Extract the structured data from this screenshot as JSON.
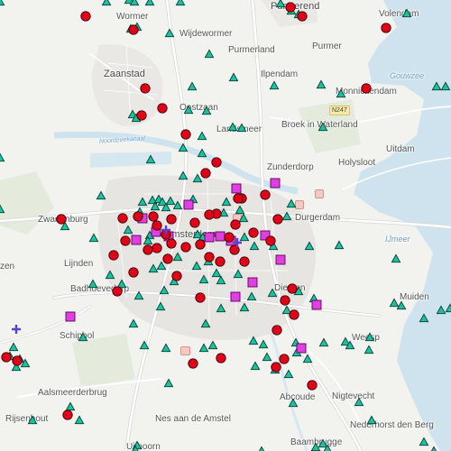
{
  "map": {
    "colors": {
      "land": "#f2f2ef",
      "water": "#cfe3ef",
      "road": "#ffffff",
      "road_edge": "#d6d6d2",
      "urban": "#e6e5e1",
      "green": "#dfe8d6",
      "circle_marker": "#e0001a",
      "triangle_marker": "#18c4a0",
      "square_marker": "#e040e0",
      "plus_marker": "#5a3fd0"
    },
    "marker_shapes": [
      "red-circle",
      "teal-triangle",
      "magenta-square",
      "purple-plus"
    ],
    "place_labels": [
      {
        "id": "wormer",
        "text": "Wormer"
      },
      {
        "id": "purmerend",
        "text": "Purmerend"
      },
      {
        "id": "volendam",
        "text": "Volendam"
      },
      {
        "id": "wijdewormer",
        "text": "Wijdewormer"
      },
      {
        "id": "purmerland",
        "text": "Purmerland"
      },
      {
        "id": "purmer",
        "text": "Purmer"
      },
      {
        "id": "zaanstad",
        "text": "Zaanstad"
      },
      {
        "id": "ilpendam",
        "text": "Ilpendam"
      },
      {
        "id": "monnickendam",
        "text": "Monnickendam"
      },
      {
        "id": "oostzaan",
        "text": "Oostzaan"
      },
      {
        "id": "landsmeer",
        "text": "Landsmeer"
      },
      {
        "id": "broek",
        "text": "Broek in Waterland"
      },
      {
        "id": "uitdam",
        "text": "Uitdam"
      },
      {
        "id": "zunderdorp",
        "text": "Zunderdorp"
      },
      {
        "id": "holysloot",
        "text": "Holysloot"
      },
      {
        "id": "zwanenburg",
        "text": "Zwanenburg"
      },
      {
        "id": "durgerdam",
        "text": "Durgerdam"
      },
      {
        "id": "amsterdam",
        "text": "Amsterdam"
      },
      {
        "id": "lijnden",
        "text": "Lijnden"
      },
      {
        "id": "badhoevedorp",
        "text": "Badhoevedorp"
      },
      {
        "id": "diemen",
        "text": "Diemen"
      },
      {
        "id": "muiden",
        "text": "Muiden"
      },
      {
        "id": "zen",
        "text": "zen"
      },
      {
        "id": "schiphol",
        "text": "Schiphol"
      },
      {
        "id": "weesp",
        "text": "Weesp"
      },
      {
        "id": "aalsmeerderbrug",
        "text": "Aalsmeerderbrug"
      },
      {
        "id": "abcoude",
        "text": "Abcoude"
      },
      {
        "id": "nigtevecht",
        "text": "Nigtevecht"
      },
      {
        "id": "rijsenhout",
        "text": "Rijsenhout"
      },
      {
        "id": "nesaandeamstel",
        "text": "Nes aan de Amstel"
      },
      {
        "id": "nederhorst",
        "text": "Nederhorst den Berg"
      },
      {
        "id": "uithoorn",
        "text": "Uithoorn"
      },
      {
        "id": "baambrugge",
        "text": "Baambrugge"
      }
    ],
    "water_labels": [
      {
        "id": "gouwzee",
        "text": "Gouwzee"
      },
      {
        "id": "ijmeer",
        "text": "IJmeer"
      },
      {
        "id": "noordzeekanaal",
        "text": "Noordzeekanaal"
      }
    ],
    "road_shields": [
      {
        "id": "n247",
        "text": "N247"
      }
    ]
  }
}
